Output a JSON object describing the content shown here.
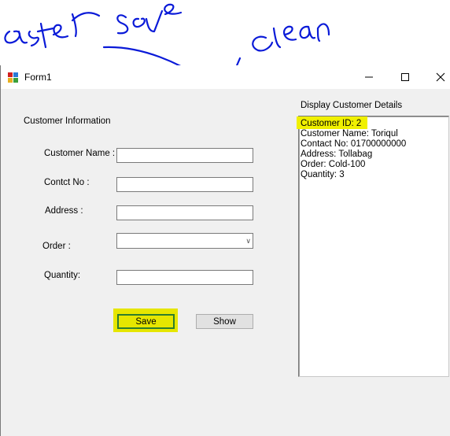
{
  "annotations": {
    "note1": "after save",
    "note2": "clean"
  },
  "window": {
    "title": "Form1",
    "icon": "form-app-icon",
    "controls": [
      "minimize-icon",
      "maximize-icon",
      "close-icon"
    ]
  },
  "form": {
    "group_title": "Customer Information",
    "fields": {
      "name_label": "Customer Name :",
      "contact_label": "Contct No :",
      "address_label": "Address :",
      "order_label": "Order :",
      "quantity_label": "Quantity:"
    },
    "values": {
      "name": "",
      "contact": "",
      "address": "",
      "order": "",
      "quantity": ""
    },
    "buttons": {
      "save_label": "Save",
      "show_label": "Show"
    }
  },
  "display": {
    "title": "Display Customer Details",
    "lines": [
      "Customer ID: 2",
      "Customer Name: Toriqul",
      "Contact No: 01700000000",
      "Address: Tollabag",
      "Order: Cold-100",
      "Quantity: 3"
    ]
  },
  "colors": {
    "highlight": "#e6e600",
    "annotation_ink": "#0a1ad8"
  }
}
